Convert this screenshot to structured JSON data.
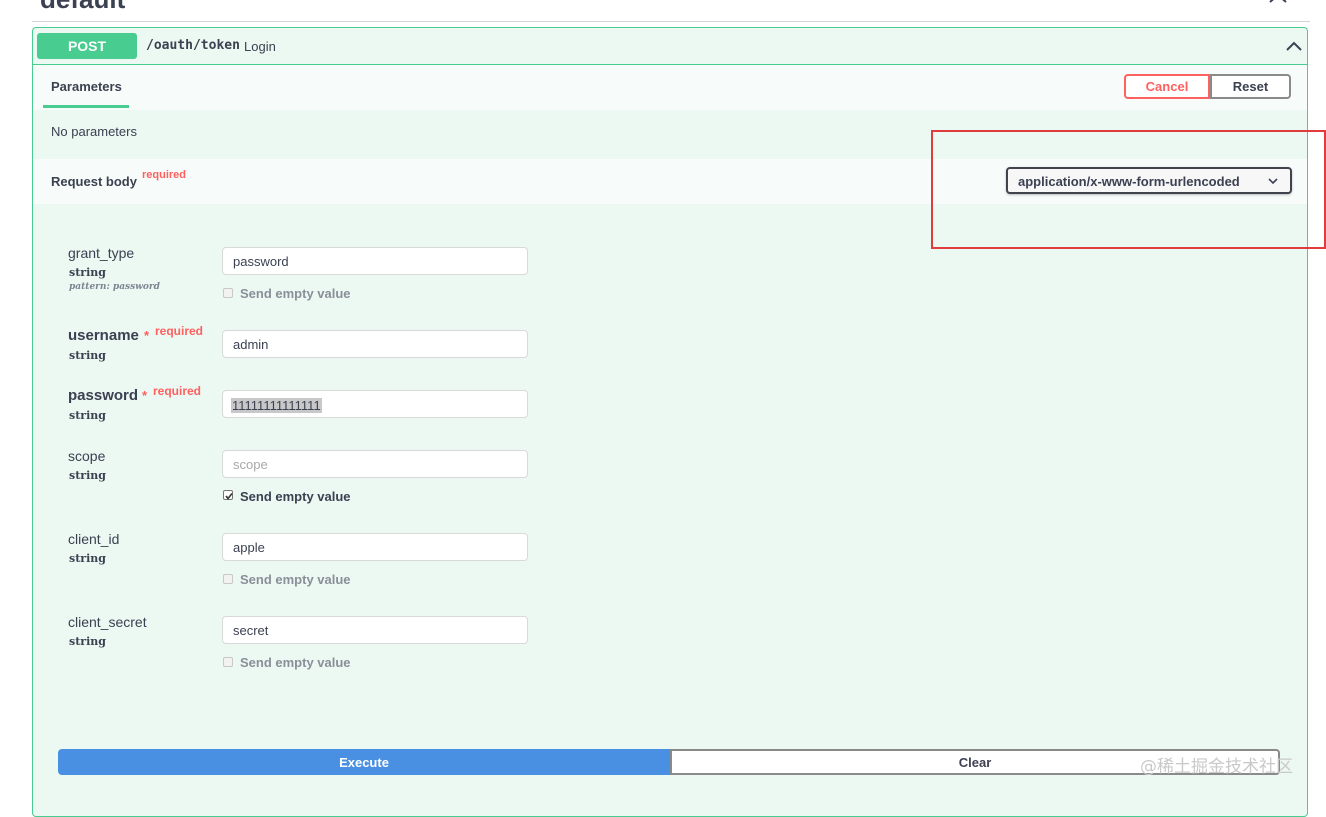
{
  "section": {
    "title": "default"
  },
  "operation": {
    "method": "POST",
    "path": "/oauth/token",
    "summary": "Login"
  },
  "parameters": {
    "tab_label": "Parameters",
    "cancel_label": "Cancel",
    "reset_label": "Reset",
    "empty_text": "No parameters"
  },
  "request_body": {
    "title": "Request body",
    "required_label": "required",
    "content_type": "application/x-www-form-urlencoded"
  },
  "fields": [
    {
      "name": "grant_type",
      "type": "string",
      "pattern": "pattern: password",
      "value": "password",
      "placeholder": "",
      "send_empty_label": "Send empty value",
      "send_empty_checked": false
    },
    {
      "name": "username",
      "type": "string",
      "required_star": "*",
      "required_text": "required",
      "value": "admin"
    },
    {
      "name": "password",
      "type": "string",
      "required_star": "*",
      "required_text": "required",
      "value": "11111111111111"
    },
    {
      "name": "scope",
      "type": "string",
      "value": "",
      "placeholder": "scope",
      "send_empty_label": "Send empty value",
      "send_empty_checked": true
    },
    {
      "name": "client_id",
      "type": "string",
      "value": "apple",
      "send_empty_label": "Send empty value",
      "send_empty_checked": false
    },
    {
      "name": "client_secret",
      "type": "string",
      "value": "secret",
      "send_empty_label": "Send empty value",
      "send_empty_checked": false
    }
  ],
  "actions": {
    "execute_label": "Execute",
    "clear_label": "Clear"
  },
  "watermark": "@稀土掘金技术社区",
  "colors": {
    "post": "#49cc90",
    "cancel": "#ff6060",
    "execute": "#4990e2",
    "highlight": "#e03c3c"
  }
}
